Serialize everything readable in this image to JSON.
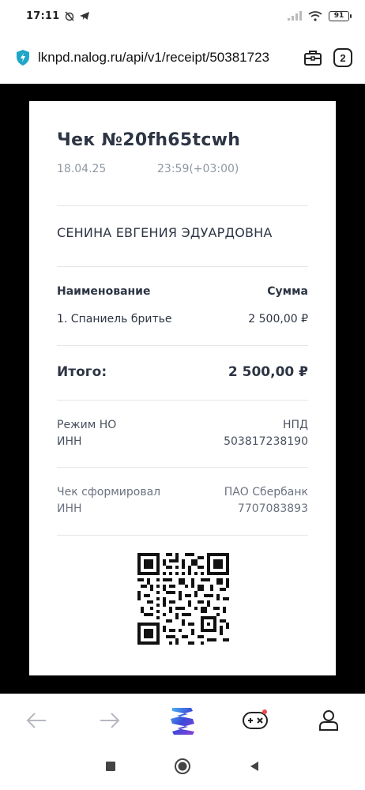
{
  "status_bar": {
    "time": "17:11",
    "battery": "91"
  },
  "url_bar": {
    "url": "lknpd.nalog.ru/api/v1/receipt/50381723",
    "tab_count": "2"
  },
  "receipt": {
    "title": "Чек №20fh65tcwh",
    "date": "18.04.25",
    "time": "23:59(+03:00)",
    "seller_name": "СЕНИНА ЕВГЕНИЯ ЭДУАРДОВНА",
    "items_header": {
      "name": "Наименование",
      "sum": "Сумма"
    },
    "items": [
      {
        "name": "1. Спаниель бритье",
        "sum": "2 500,00 ₽"
      }
    ],
    "total": {
      "label": "Итого:",
      "value": "2 500,00 ₽"
    },
    "tax_mode": {
      "label": "Режим НО",
      "value": "НПД"
    },
    "seller_inn": {
      "label": "ИНН",
      "value": "503817238190"
    },
    "issuer": {
      "label": "Чек сформировал",
      "value": "ПАО Сбербанк"
    },
    "issuer_inn": {
      "label": "ИНН",
      "value": "7707083893"
    }
  },
  "colors": {
    "page_bg": "#000000",
    "receipt_bg": "#ffffff",
    "text_dark": "#2d3544",
    "text_muted": "#9097a3",
    "shield": "#1fa6c8",
    "brand_logo": "#3b4ad8"
  },
  "icons": {
    "shield": "shield-icon",
    "briefcase": "briefcase-icon",
    "back": "back-arrow-icon",
    "forward": "forward-arrow-icon",
    "browser_logo": "browser-logo-icon",
    "games": "gamepad-icon",
    "profile": "profile-icon"
  }
}
